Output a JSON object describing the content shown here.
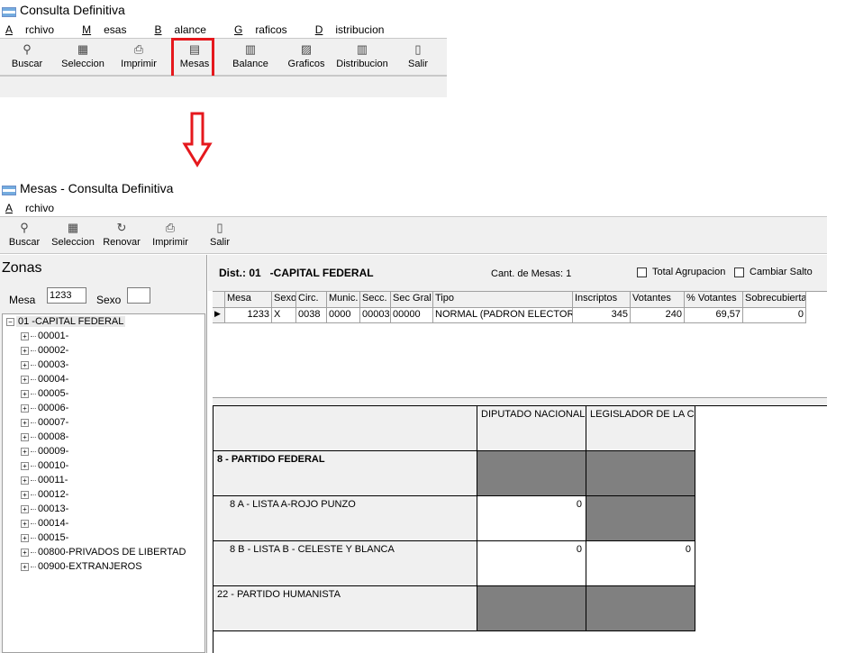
{
  "top_window": {
    "title": "Consulta Definitiva",
    "menu": [
      {
        "u": "A",
        "rest": "rchivo"
      },
      {
        "u": "M",
        "rest": "esas"
      },
      {
        "u": "B",
        "rest": "alance"
      },
      {
        "u": "G",
        "rest": "raficos"
      },
      {
        "u": "D",
        "rest": "istribucion"
      }
    ],
    "toolbar": [
      {
        "label": "Buscar",
        "icon": "search-icon"
      },
      {
        "label": "Seleccion",
        "icon": "selection-icon"
      },
      {
        "label": "Imprimir",
        "icon": "printer-icon"
      },
      {
        "label": "Mesas",
        "icon": "mesas-icon",
        "highlighted": true
      },
      {
        "label": "Balance",
        "icon": "calculator-icon"
      },
      {
        "label": "Graficos",
        "icon": "chart-icon"
      },
      {
        "label": "Distribucion",
        "icon": "calculator-icon"
      },
      {
        "label": "Salir",
        "icon": "exit-door-icon"
      }
    ],
    "highlight_color": "#e5181d"
  },
  "arrow_color": "#e5181d",
  "mesas_window": {
    "title": "Mesas - Consulta Definitiva",
    "menu": [
      {
        "u": "A",
        "rest": "rchivo"
      }
    ],
    "toolbar": [
      {
        "label": "Buscar",
        "icon": "search-icon"
      },
      {
        "label": "Seleccion",
        "icon": "selection-icon"
      },
      {
        "label": "Renovar",
        "icon": "refresh-icon"
      },
      {
        "label": "Imprimir",
        "icon": "printer-icon"
      },
      {
        "label": "Salir",
        "icon": "exit-door-icon"
      }
    ],
    "zonas": {
      "title": "Zonas",
      "mesa_label": "Mesa",
      "mesa_value": "1233",
      "sexo_label": "Sexo",
      "sexo_value": "",
      "root": "01  -CAPITAL FEDERAL",
      "items": [
        "00001-",
        "00002-",
        "00003-",
        "00004-",
        "00005-",
        "00006-",
        "00007-",
        "00008-",
        "00009-",
        "00010-",
        "00011-",
        "00012-",
        "00013-",
        "00014-",
        "00015-",
        "00800-PRIVADOS DE LIBERTAD",
        "00900-EXTRANJEROS"
      ]
    },
    "header": {
      "dist": "Dist.: 01   -CAPITAL FEDERAL",
      "cant_mesas": "Cant. de Mesas: 1",
      "total_agrupacion": "Total Agrupacion",
      "cambiar_salto": "Cambiar Salto"
    },
    "table": {
      "columns": [
        "Mesa",
        "Sexo",
        "Circ.",
        "Munic.",
        "Secc.",
        "Sec Gral",
        "Tipo",
        "Inscriptos",
        "Votantes",
        "% Votantes",
        "Sobrecubierta"
      ],
      "rows": [
        [
          "1233",
          "X",
          "0038",
          "0000",
          "00003",
          "00000",
          "NORMAL (PADRON ELECTORAL",
          "345",
          "240",
          "69,57",
          "0"
        ]
      ]
    },
    "results": {
      "columns": [
        "DIPUTADO NACIONAL",
        "LEGISLADOR  DE LA CI"
      ],
      "rows": [
        {
          "label": "8 - PARTIDO FEDERAL",
          "bold": true,
          "values": [
            "",
            ""
          ],
          "gray": [
            true,
            true
          ]
        },
        {
          "label": "8 A - LISTA A-ROJO PUNZO",
          "bold": false,
          "values": [
            "0",
            ""
          ],
          "gray": [
            false,
            true
          ]
        },
        {
          "label": "8 B - LISTA B - CELESTE Y BLANCA",
          "bold": false,
          "values": [
            "0",
            "0"
          ],
          "gray": [
            false,
            false
          ]
        },
        {
          "label": "22 - PARTIDO HUMANISTA",
          "bold": false,
          "values": [
            "",
            ""
          ],
          "gray": [
            true,
            true
          ]
        }
      ]
    }
  }
}
